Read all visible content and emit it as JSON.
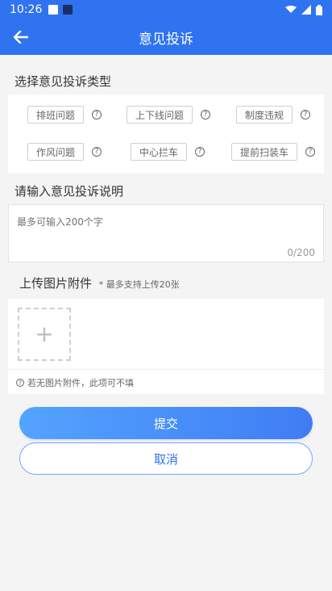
{
  "status": {
    "time": "10:26"
  },
  "app_bar": {
    "title": "意见投诉"
  },
  "section_type_title": "选择意见投诉类型",
  "types": [
    {
      "label": "排班问题"
    },
    {
      "label": "上下线问题"
    },
    {
      "label": "制度违规"
    },
    {
      "label": "作风问题"
    },
    {
      "label": "中心拦车"
    },
    {
      "label": "提前扫装车"
    }
  ],
  "help_glyph": "?",
  "section_desc_title": "请输入意见投诉说明",
  "desc": {
    "placeholder": "最多可输入200个字",
    "counter": "0/200"
  },
  "upload": {
    "title": "上传图片附件",
    "subtitle": "* 最多支持上传20张",
    "plus": "+",
    "hint": "若无图片附件，此项可不填"
  },
  "buttons": {
    "submit": "提交",
    "cancel": "取消"
  },
  "colors": {
    "primary": "#2f73f0",
    "accent_gradient_start": "#53a4ff",
    "accent_gradient_end": "#3f7cf4"
  }
}
